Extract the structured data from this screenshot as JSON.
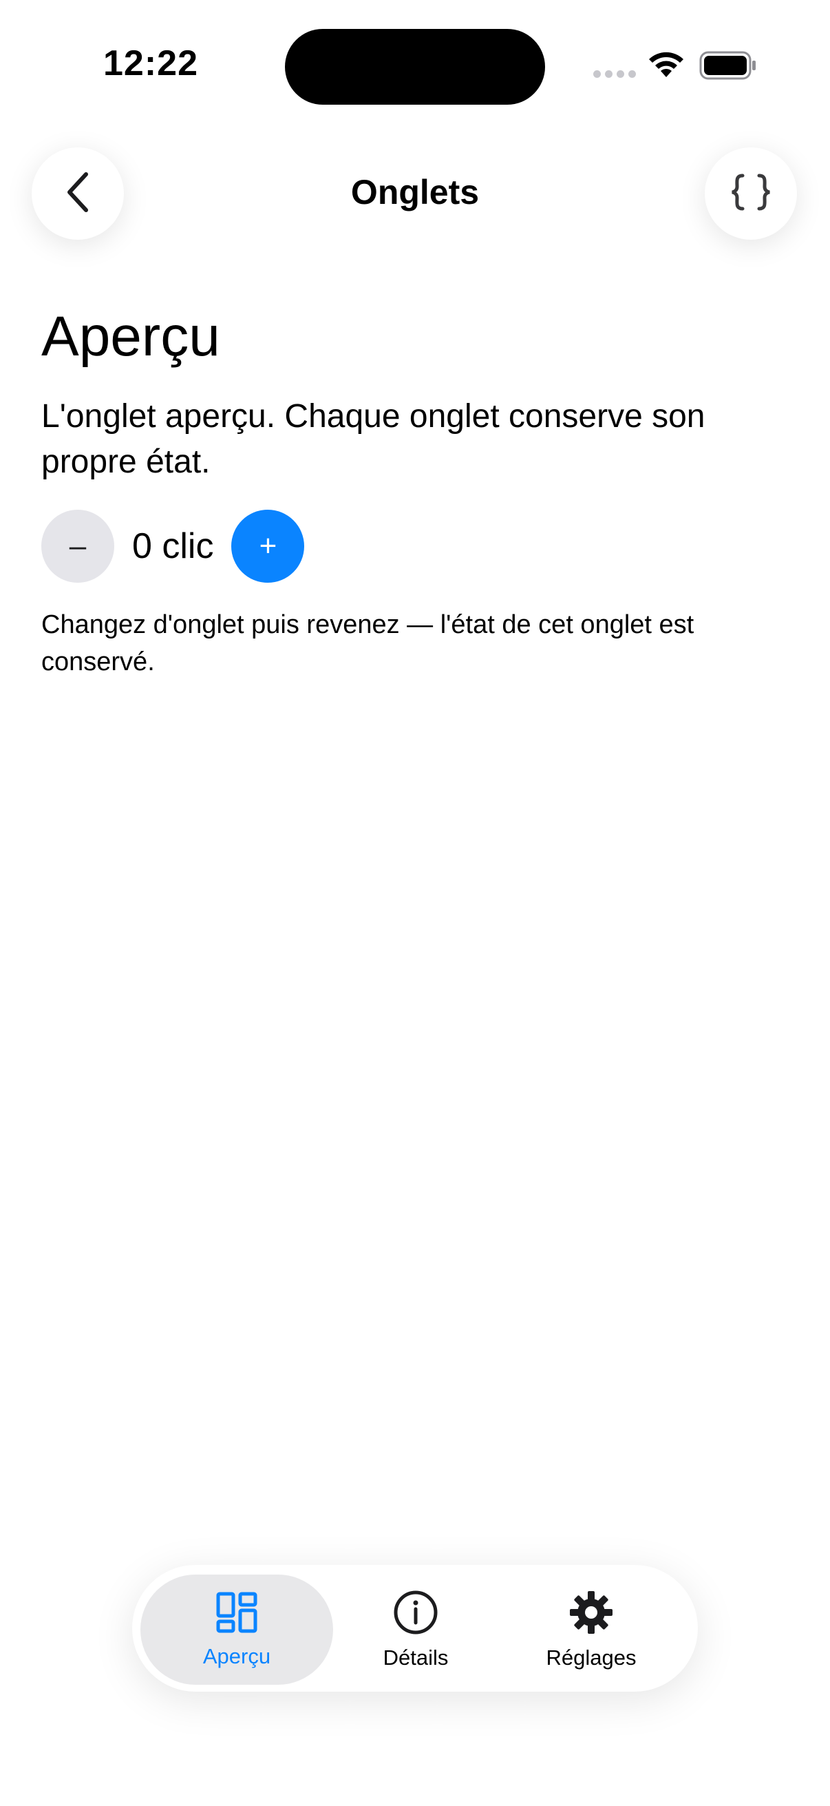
{
  "status_bar": {
    "time": "12:22"
  },
  "nav": {
    "title": "Onglets",
    "back_icon": "chevron-left-icon",
    "action_icon": "curly-braces-icon"
  },
  "main": {
    "heading": "Aperçu",
    "description": "L'onglet aperçu. Chaque onglet conserve son propre état.",
    "counter": {
      "minus_label": "–",
      "value_text": "0 clic",
      "plus_label": "+"
    },
    "helper": "Changez d'onglet puis revenez — l'état de cet onglet est conservé."
  },
  "tabbar": {
    "tabs": [
      {
        "label": "Aperçu",
        "icon": "dashboard-icon",
        "active": true
      },
      {
        "label": "Détails",
        "icon": "info-icon",
        "active": false
      },
      {
        "label": "Réglages",
        "icon": "gear-icon",
        "active": false
      }
    ]
  },
  "colors": {
    "accent": "#0a84ff",
    "secondary_button": "#e5e5ea",
    "active_tab_background": "#e8e8ea"
  }
}
